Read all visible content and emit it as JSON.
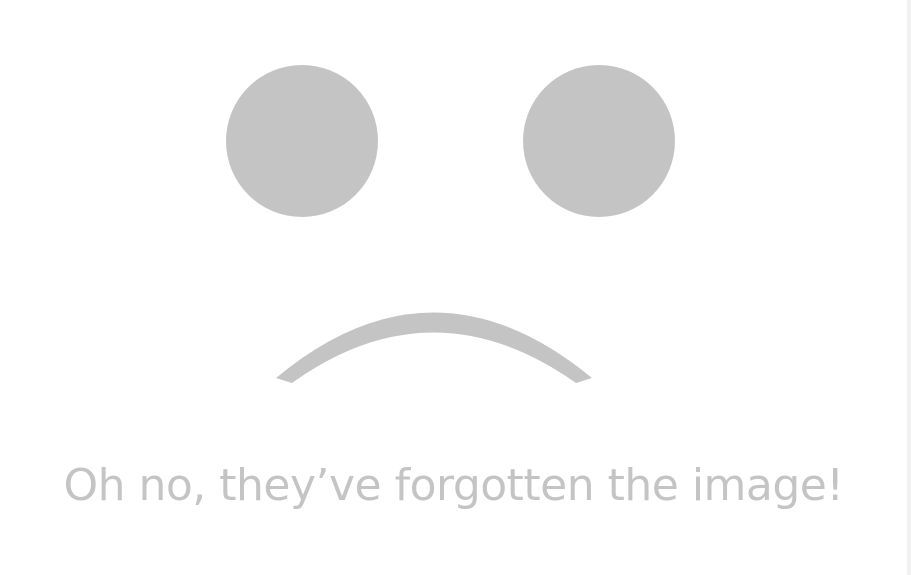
{
  "message": "Oh no, they’ve forgotten the image!",
  "colors": {
    "background": "#ffffff",
    "shape": "#c4c4c4",
    "text": "#c4c4c4",
    "edge": "#f1f1f1"
  },
  "icons": {
    "face": "sad-face-icon"
  }
}
